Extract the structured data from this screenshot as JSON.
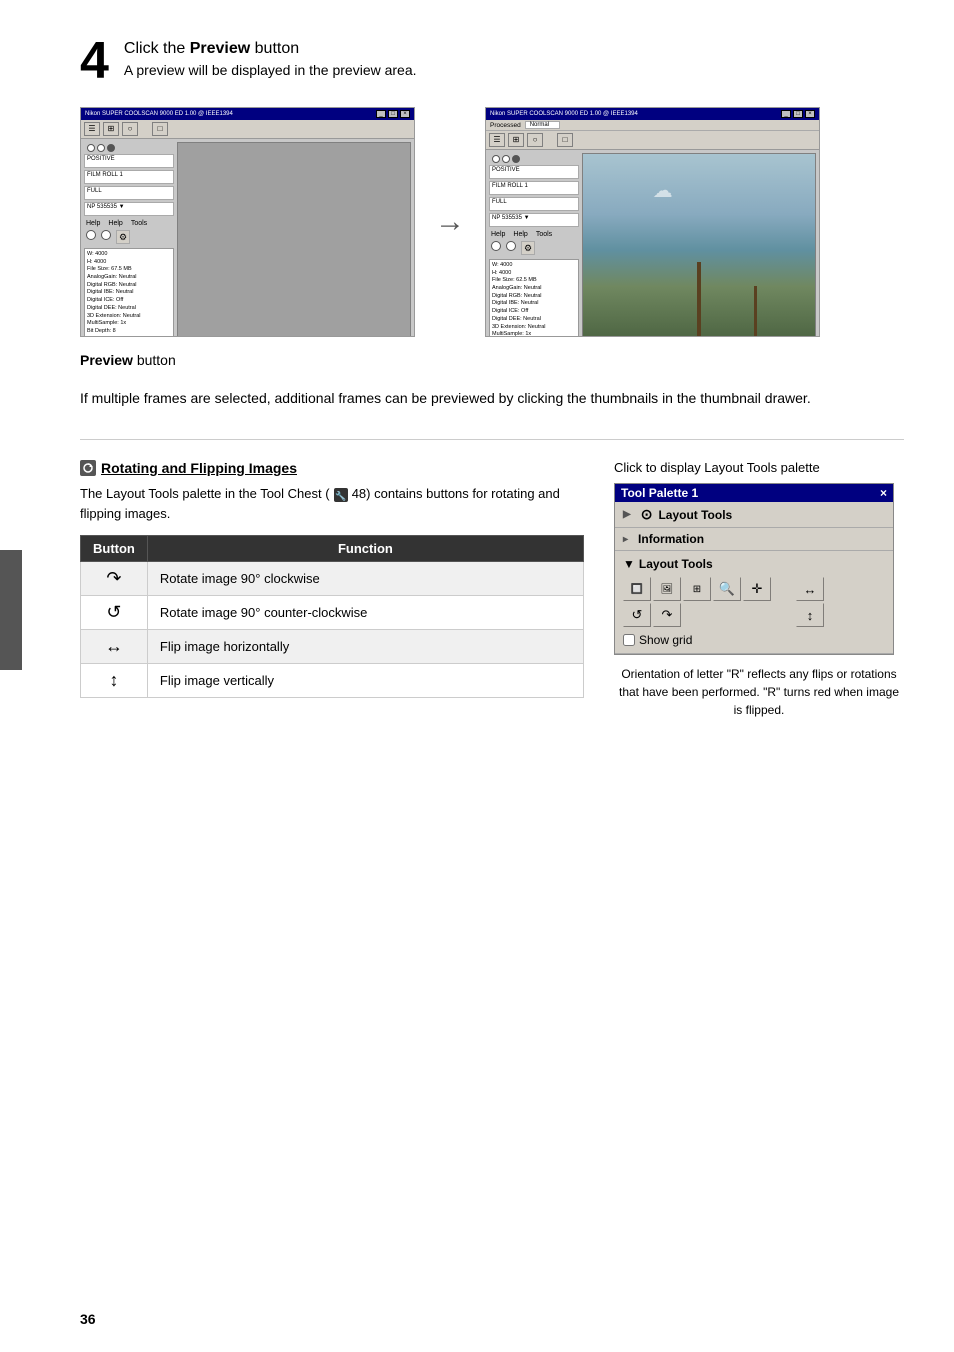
{
  "page": {
    "number": "36",
    "background": "#ffffff"
  },
  "step": {
    "number": "4",
    "heading": "Click the ",
    "heading_bold": "Preview",
    "heading_suffix": " button",
    "subheading": "A preview will be displayed in the preview area."
  },
  "screenshots": {
    "before_title": "Nikon SUPER COOLSCAN 9000 ED 1.00 @ IEEE1394",
    "after_title": "Nikon SUPER COOLSCAN 9000 ED 1.00 @ IEEE1394",
    "arrow": "→"
  },
  "preview_button_label": "Preview",
  "preview_button_suffix": " button",
  "description": "If multiple frames are selected, additional frames can be previewed by clicking the thumbnails in the thumbnail drawer.",
  "rotating_section": {
    "icon": "🔍",
    "heading": "Rotating and Flipping Images",
    "intro": "The Layout Tools palette in the Tool Chest (",
    "chest_ref": "48",
    "intro_suffix": ") contains buttons for rotating and flipping images.",
    "table": {
      "col1_header": "Button",
      "col2_header": "Function",
      "rows": [
        {
          "button_symbol": "↷",
          "function": "Rotate image 90° clockwise"
        },
        {
          "button_symbol": "↺",
          "function": "Rotate image 90° counter-clockwise"
        },
        {
          "button_symbol": "↔",
          "function": "Flip image horizontally"
        },
        {
          "button_symbol": "↕",
          "function": "Flip image vertically"
        }
      ]
    }
  },
  "palette_section": {
    "click_label": "Click to display Layout Tools palette",
    "window_title": "Tool Palette 1",
    "window_close": "×",
    "layout_tools_label": "Layout Tools",
    "layout_tools_expand": "▶",
    "information_label": "Information",
    "information_expand": "▸",
    "layout_tools_section_label": "Layout Tools",
    "layout_tools_section_expand": "▼",
    "buttons": [
      "🔲",
      "⚡",
      "⬜",
      "🔍",
      "✛",
      "↺",
      "↷"
    ],
    "right_buttons_row1": [
      "↔"
    ],
    "right_buttons_row2": [
      "↕"
    ],
    "show_grid": "Show grid",
    "caption": "Orientation of letter \"R\" reflects any flips\nor rotations that have been performed.  \"R\"\nturns red when image is flipped."
  },
  "scanner_info": {
    "w": "4000",
    "h": "4000",
    "file_size": "62.5 MB",
    "analog_gain": "Neutral",
    "digital_rgb": "Neutral",
    "digital_ibe": "Neutral",
    "digital_ice": "Off",
    "digital_dee": "Neutral",
    "infrared_scan": "Neutral",
    "multi_sample": "1x",
    "bit_depth": "8"
  }
}
